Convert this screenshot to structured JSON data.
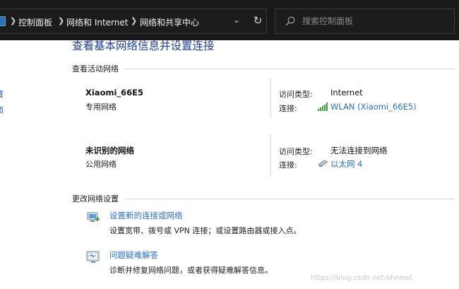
{
  "address_bar": {
    "breadcrumbs": [
      "控制面板",
      "网络和 Internet",
      "网络和共享中心"
    ]
  },
  "search": {
    "placeholder": "搜索控制面板"
  },
  "left_nav": {
    "items": [
      "置",
      "项"
    ]
  },
  "main": {
    "title": "查看基本网络信息并设置连接",
    "active_networks_heading": "查看活动网络",
    "networks": [
      {
        "name": "Xiaomi_66E5",
        "category": "专用网络",
        "access_type_label": "访问类型:",
        "access_type_value": "Internet",
        "connection_label": "连接:",
        "connection_value": "WLAN (Xiaomi_66E5)",
        "connection_icon": "wifi-signal-icon"
      },
      {
        "name": "未识别的网络",
        "category": "公用网络",
        "access_type_label": "访问类型:",
        "access_type_value": "无法连接到网络",
        "connection_label": "连接:",
        "connection_value": "以太网 4",
        "connection_icon": "ethernet-icon"
      }
    ],
    "change_settings_heading": "更改网络设置",
    "tasks": [
      {
        "link": "设置新的连接或网络",
        "description": "设置宽带、拨号或 VPN 连接；或设置路由器或接入点。",
        "icon": "new-connection-icon"
      },
      {
        "link": "问题疑难解答",
        "description": "诊断并修复网络问题，或者获得疑难解答信息。",
        "icon": "troubleshoot-icon"
      }
    ]
  },
  "watermark": "https://blog.csdn.net/ahnewt",
  "colors": {
    "title": "#1e3e9a",
    "link": "#2a6ec6",
    "topbar": "#191919"
  }
}
